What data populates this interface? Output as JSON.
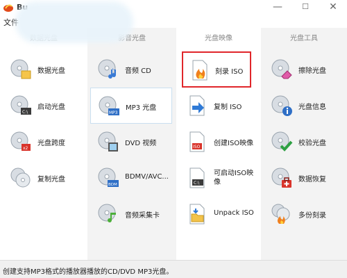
{
  "window": {
    "title": "Bu",
    "minimize": "—",
    "maximize": "☐",
    "close": "✕"
  },
  "menu": {
    "file": "文件"
  },
  "columns": [
    {
      "header": "数据光盘"
    },
    {
      "header": "影音光盘"
    },
    {
      "header": "光盘映像"
    },
    {
      "header": "光盘工具"
    }
  ],
  "items": {
    "data_disc": "数据光盘",
    "boot_disc": "启动光盘",
    "span_disc": "光盘跨度",
    "copy_disc": "复制光盘",
    "audio_cd": "音频 CD",
    "mp3_disc": "MP3 光盘",
    "dvd_video": "DVD 视频",
    "bdmv": "BDMV/AVC...",
    "audio_capture": "音频采集卡",
    "burn_iso": "刻录 ISO",
    "copy_iso": "复制 ISO",
    "create_iso": "创建ISO映像",
    "bootable_iso": "可启动ISO映像",
    "unpack_iso": "Unpack ISO",
    "erase_disc": "擦除光盘",
    "disc_info": "光盘信息",
    "verify_disc": "校验光盘",
    "data_recovery": "数据恢复",
    "multi_burn": "多份刻录"
  },
  "status": {
    "text": "创建支持MP3格式的播放器播放的CD/DVD MP3光盘。"
  }
}
